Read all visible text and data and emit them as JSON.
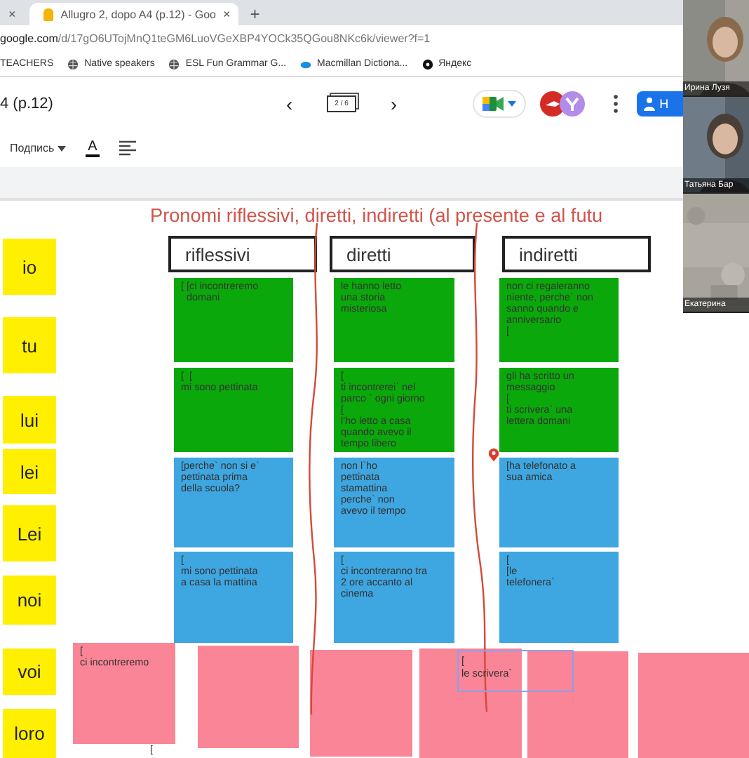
{
  "browser": {
    "tabs": [
      {
        "selected": false,
        "close": "×"
      },
      {
        "selected": true,
        "title": "Allugro 2, dopo A4 (p.12) - Goo",
        "close": "×"
      }
    ],
    "new_tab": "+",
    "address": {
      "host": "google.com",
      "path": "/d/17gO6UTojMnQ1teGM6LuoVGeXBP4YOCk35QGou8NKc6k/viewer?f=1"
    },
    "bookmarks": [
      {
        "kind": "folder",
        "label": "TEACHERS"
      },
      {
        "kind": "globe",
        "label": "Native speakers"
      },
      {
        "kind": "globe",
        "label": "ESL Fun Grammar G..."
      },
      {
        "kind": "cloud",
        "label": "Macmillan Dictiona..."
      },
      {
        "kind": "dot",
        "label": "Яндекс"
      }
    ]
  },
  "app": {
    "title": "4 (p.12)",
    "prev": "‹",
    "page": "2 / 6",
    "next": "›",
    "share": "Н",
    "format": {
      "style": "Подпись",
      "text_color": "A"
    }
  },
  "board": {
    "title": "Pronomi riflessivi, diretti, indiretti (al presente e al futu",
    "row_labels": [
      "io",
      "tu",
      "lui",
      "lei",
      "Lei",
      "noi",
      "voi",
      "loro"
    ],
    "columns": [
      {
        "heading": "riflessivi",
        "notes": [
          {
            "color": "#0aa80a",
            "text": "[ [ci incontreremo\n  domani"
          },
          {
            "color": "#0aa80a",
            "text": "[  [\nmi sono pettinata"
          },
          {
            "color": "#3ea6e0",
            "text": "[perche` non si e`\npettinata prima\ndella scuola?"
          },
          {
            "color": "#3ea6e0",
            "text": "[\nmi sono pettinata\na casa la mattina"
          }
        ]
      },
      {
        "heading": "diretti",
        "notes": [
          {
            "color": "#0aa80a",
            "text": "le hanno letto\nuna storia\nmisteriosa"
          },
          {
            "color": "#0aa80a",
            "text": "[\nti incontrerei` nel\nparco ` ogni giorno\n[\nl'ho letto a casa\nquando avevo il\ntempo libero"
          },
          {
            "color": "#3ea6e0",
            "text": "non l`ho\npettinata\nstamattina\nperche` non\navevo il tempo"
          },
          {
            "color": "#3ea6e0",
            "text": "[\nci incontreranno tra\n2 ore accanto al\ncinema"
          }
        ]
      },
      {
        "heading": "indiretti",
        "notes": [
          {
            "color": "#0aa80a",
            "text": "non ci regaleranno\nniente, perche` non\nsanno quando e\nanniversario\n["
          },
          {
            "color": "#0aa80a",
            "text": "gli ha scritto un\nmessaggio\n[\nti scrivera` una\nlettera domani"
          },
          {
            "color": "#3ea6e0",
            "text": "[ha telefonato a\nsua amica"
          },
          {
            "color": "#3ea6e0",
            "text": "[\n[le\ntelefonera`"
          }
        ]
      }
    ],
    "bottom_notes": [
      {
        "color": "#fa8597",
        "text": "[\nci incontreremo"
      },
      {
        "color": "#fa8597"
      },
      {
        "color": "#fa8597"
      },
      {
        "color": "#fa8597"
      },
      {
        "color": "#fa8597"
      },
      {
        "color": "#fa8597"
      }
    ],
    "selection": {
      "text": "[\nle scrivera`"
    },
    "stray_marks": [
      "["
    ]
  },
  "participants": [
    {
      "name": "Ирина Лузя"
    },
    {
      "name": "Татьяна Бар"
    },
    {
      "name": "Екатерина"
    }
  ]
}
